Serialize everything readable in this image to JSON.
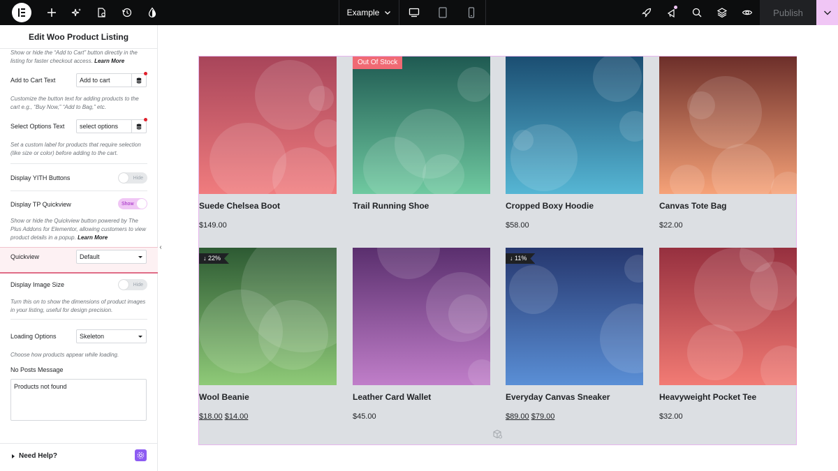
{
  "topbar": {
    "page_name": "Example",
    "publish_label": "Publish",
    "icons": [
      "elementor-logo-icon",
      "plus-icon",
      "sparkle-icon",
      "page-settings-icon",
      "history-icon",
      "theme-drop-icon",
      "desktop-icon",
      "tablet-icon",
      "mobile-icon",
      "rocket-icon",
      "notifications-icon",
      "search-icon",
      "layers-icon",
      "preview-eye-icon",
      "chevron-down-icon"
    ]
  },
  "panel": {
    "title": "Edit Woo Product Listing",
    "help_add_to_cart_text": "Show or hide the “Add to Cart” button directly in the listing for faster checkout access.",
    "learn_more": "Learn More",
    "add_to_cart_label": "Add to Cart Text",
    "add_to_cart_value": "Add to cart",
    "help_button_text": "Customize the button text for adding products to the cart e.g., “Buy Now,” “Add to Bag,” etc.",
    "select_options_label": "Select Options Text",
    "select_options_value": "select options",
    "help_select_options": "Set a custom label for products that require selection (like size or color) before adding to the cart.",
    "yith_label": "Display YITH Buttons",
    "yith_state": "Hide",
    "quickview_toggle_label": "Display TP Quickview",
    "quickview_toggle_state": "Show",
    "help_quickview_text": "Show or hide the Quickview button powered by The Plus Addons for Elementor, allowing customers to view product details in a popup.",
    "quickview_label": "Quickview",
    "quickview_value": "Default",
    "image_size_label": "Display Image Size",
    "image_size_state": "Hide",
    "help_image_size": "Turn this on to show the dimensions of product images in your listing, useful for design precision.",
    "loading_label": "Loading Options",
    "loading_value": "Skeleton",
    "help_loading": "Choose how products appear while loading.",
    "no_posts_label": "No Posts Message",
    "no_posts_value": "Products not found",
    "need_help": "Need Help?",
    "colors": {
      "accent": "#f0c6f5",
      "highlight_border": "#e06c86",
      "required_dot": "#e0202c"
    }
  },
  "products": [
    {
      "name": "Suede Chelsea Boot",
      "currency": "$",
      "price": "149.00",
      "old_price": "",
      "badge": "",
      "gradient": [
        "#a8455a",
        "#f07c7e"
      ]
    },
    {
      "name": "Trail Running Shoe",
      "currency": "$",
      "price": "",
      "old_price": "",
      "badge": "Out Of Stock",
      "gradient": [
        "#1f5a52",
        "#6fc9a0"
      ]
    },
    {
      "name": "Cropped Boxy Hoodie",
      "currency": "$",
      "price": "58.00",
      "old_price": "",
      "badge": "",
      "gradient": [
        "#1b4e72",
        "#56b6d4"
      ]
    },
    {
      "name": "Canvas Tote Bag",
      "currency": "$",
      "price": "22.00",
      "old_price": "",
      "badge": "",
      "gradient": [
        "#6d2f2a",
        "#f6a278"
      ]
    },
    {
      "name": "Wool Beanie",
      "currency": "$",
      "price": "14.00",
      "old_price": "18.00",
      "badge": "↓ 22%",
      "gradient": [
        "#2d5a33",
        "#8fca78"
      ]
    },
    {
      "name": "Leather Card Wallet",
      "currency": "$",
      "price": "45.00",
      "old_price": "",
      "badge": "",
      "gradient": [
        "#5a2f6e",
        "#c07ec9"
      ]
    },
    {
      "name": "Everyday Canvas Sneaker",
      "currency": "$",
      "price": "79.00",
      "old_price": "89.00",
      "badge": "↓ 11%",
      "gradient": [
        "#26376e",
        "#5a8fd6"
      ]
    },
    {
      "name": "Heavyweight Pocket Tee",
      "currency": "$",
      "price": "32.00",
      "old_price": "",
      "badge": "",
      "gradient": [
        "#96303f",
        "#f27b74"
      ]
    }
  ]
}
